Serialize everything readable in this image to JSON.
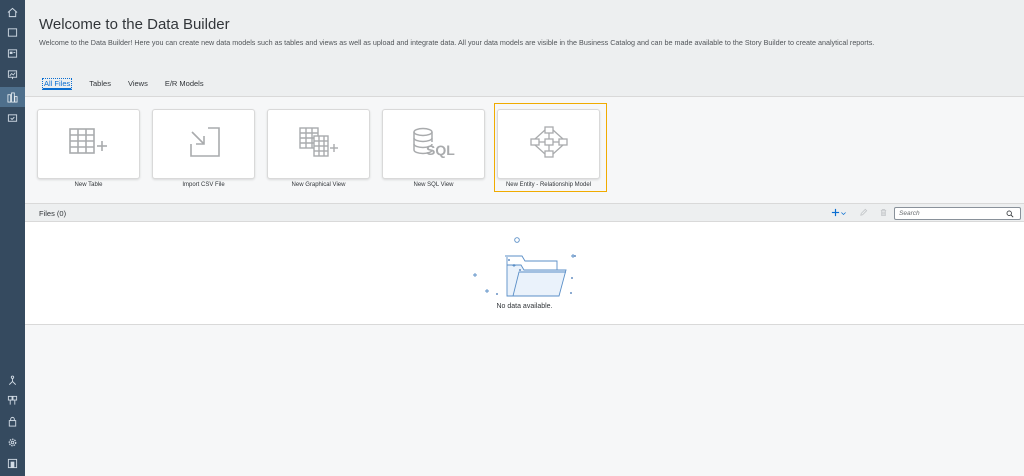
{
  "nav": {
    "items": [
      {
        "name": "home-icon"
      },
      {
        "name": "repository-icon"
      },
      {
        "name": "business-catalog-icon"
      },
      {
        "name": "story-builder-icon"
      },
      {
        "name": "data-builder-icon",
        "active": true
      },
      {
        "name": "data-integration-icon"
      }
    ],
    "bottom_items": [
      {
        "name": "connections-icon"
      },
      {
        "name": "space-management-icon"
      },
      {
        "name": "security-icon"
      },
      {
        "name": "settings-icon"
      },
      {
        "name": "system-icon"
      }
    ]
  },
  "header": {
    "title": "Welcome to the Data Builder",
    "description": "Welcome to the Data Builder! Here you can create new data models such as tables and views as well as upload and integrate data. All your data models are visible in the Business Catalog and can be made available to the Story Builder to create analytical reports.",
    "tabs": [
      {
        "label": "All Files",
        "active": true
      },
      {
        "label": "Tables"
      },
      {
        "label": "Views"
      },
      {
        "label": "E/R Models"
      }
    ]
  },
  "tiles": [
    {
      "label": "New Table",
      "icon": "table-add-icon"
    },
    {
      "label": "Import CSV File",
      "icon": "import-arrow-icon"
    },
    {
      "label": "New Graphical View",
      "icon": "graphical-view-icon"
    },
    {
      "label": "New SQL View",
      "icon": "sql-icon"
    },
    {
      "label": "New Entity - Relationship Model",
      "icon": "er-model-icon",
      "focused": true
    }
  ],
  "files": {
    "title": "Files (0)",
    "search_placeholder": "Search",
    "empty_text": "No data available."
  },
  "colors": {
    "nav_bg": "#354a5f",
    "accent": "#0a6ed1",
    "focus": "#f0ab00",
    "icon_gray": "#a9abad"
  }
}
